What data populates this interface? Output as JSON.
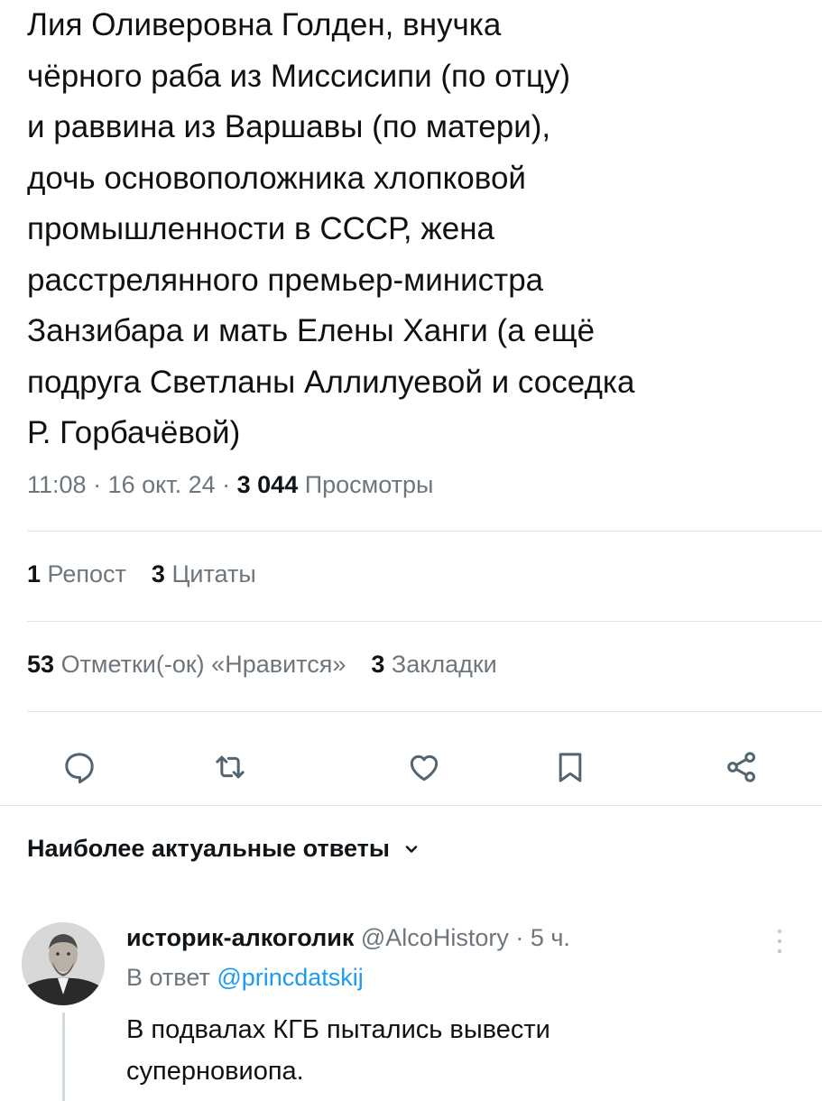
{
  "tweet": {
    "text": "Лия Оливеровна Голден, внучка\nчёрного раба из Миссисипи (по отцу)\nи раввина из Варшавы (по матери),\nдочь основоположника хлопковой\nпромышленности в СССР, жена\nрасстрелянного премьер-министра\nЗанзибара и мать Елены Ханги (а ещё\nподруга Светланы Аллилуевой и соседка\nР. Горбачёвой)",
    "time": "11:08",
    "separator": " · ",
    "date": "16 окт. 24",
    "views_count": "3 044",
    "views_label": "Просмотры"
  },
  "stats": {
    "reposts_count": "1",
    "reposts_label": "Репост",
    "quotes_count": "3",
    "quotes_label": "Цитаты",
    "likes_count": "53",
    "likes_label": "Отметки(-ок) «Нравится»",
    "bookmarks_count": "3",
    "bookmarks_label": "Закладки"
  },
  "actions": [
    {
      "name": "reply",
      "icon": "speech-bubble-icon"
    },
    {
      "name": "repost",
      "icon": "repost-arrows-icon"
    },
    {
      "name": "like",
      "icon": "heart-icon"
    },
    {
      "name": "bookmark",
      "icon": "bookmark-icon"
    },
    {
      "name": "share",
      "icon": "share-nodes-icon"
    }
  ],
  "replies_section": {
    "heading": "Наиболее актуальные ответы"
  },
  "reply": {
    "author_name": "историк-алкоголик",
    "author_handle": "@AlcoHistory",
    "separator": " · ",
    "time_ago": "5 ч.",
    "reply_to_label": "В ответ",
    "reply_to_handle": "@princdatskij",
    "text": "В подвалах КГБ пытались вывести\nсуперновиопа."
  },
  "colors": {
    "text_primary": "#0f1419",
    "text_secondary": "#6e767d",
    "link": "#1d9bf0",
    "divider": "#e1e6ea",
    "icon": "#536471"
  }
}
